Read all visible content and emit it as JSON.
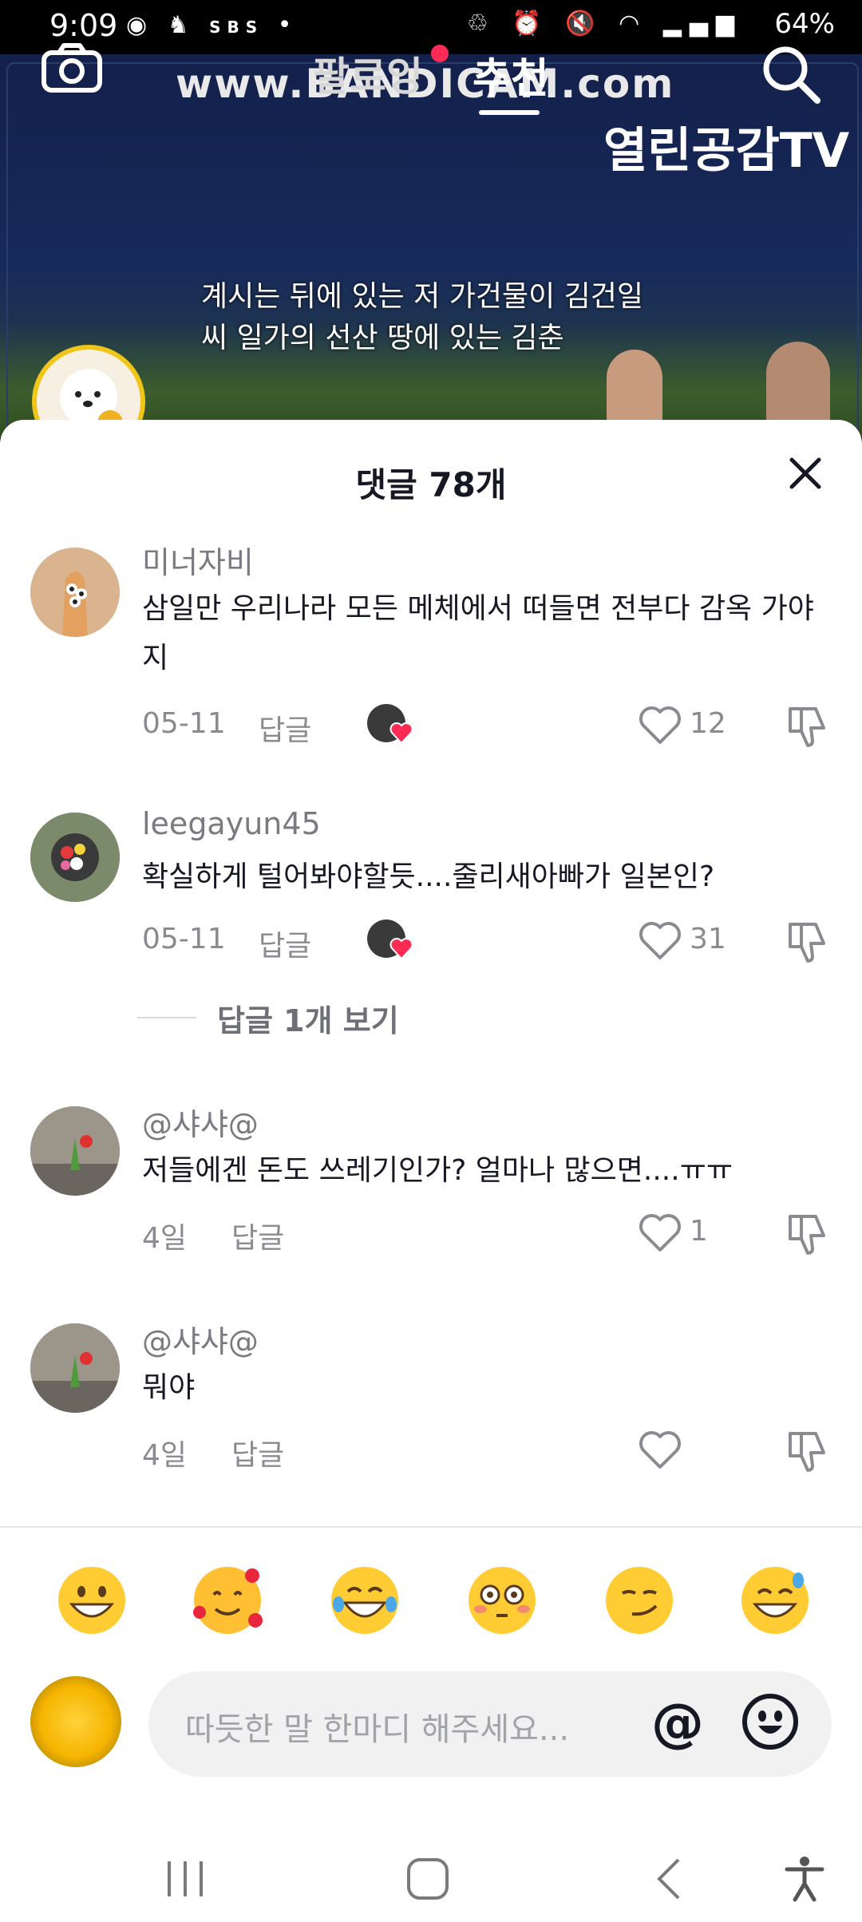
{
  "status_bar": {
    "time": "9:09",
    "battery": "64%",
    "left_icons": [
      "chrome-icon",
      "app-icon",
      "sbs-news-icon",
      "dot-icon"
    ],
    "right_icons": [
      "recycle-icon",
      "alarm-icon",
      "mute-icon",
      "wifi-icon",
      "signal-icon",
      "battery-icon"
    ]
  },
  "video": {
    "watermark": "www.BANDICAM.com",
    "channel_logo": "열린공감TV",
    "subtitle_line1": "계시는 뒤에 있는 저 가건물이 김건일",
    "subtitle_line2": "씨 일가의 선산 땅에 있는 김춘"
  },
  "top_tabs": {
    "following": "팔로잉",
    "for_you": "추천"
  },
  "sheet": {
    "title": "댓글 78개"
  },
  "comments": [
    {
      "name": "미너자비",
      "text_line1": "삼일만 우리나라 모든 메체에서 떠들면 전부다 감옥 가야",
      "text_line2": "지",
      "date": "05-11",
      "reply": "답글",
      "likes": "12"
    },
    {
      "name": "leegayun45",
      "text_line1": "확실하게 털어봐야할듯....줄리새아빠가 일본인?",
      "date": "05-11",
      "reply": "답글",
      "likes": "31",
      "view_replies": "답글 1개 보기"
    },
    {
      "name": "@샤샤@",
      "text_line1": "저들에겐 돈도 쓰레기인가? 얼마나 많으면....ㅠㅠ",
      "date": "4일",
      "reply": "답글",
      "likes": "1"
    },
    {
      "name": "@샤샤@",
      "text_line1": "뭐야",
      "date": "4일",
      "reply": "답글",
      "likes": ""
    }
  ],
  "emoji_bar": [
    "grinning-face",
    "smiling-face-with-hearts",
    "tears-of-joy",
    "flushed-face",
    "smirking-face",
    "grinning-sweat-face"
  ],
  "input": {
    "placeholder": "따듯한 말 한마디 해주세요...",
    "at_symbol": "@"
  },
  "nav": [
    "recent-apps-icon",
    "home-icon",
    "back-icon",
    "accessibility-icon"
  ]
}
